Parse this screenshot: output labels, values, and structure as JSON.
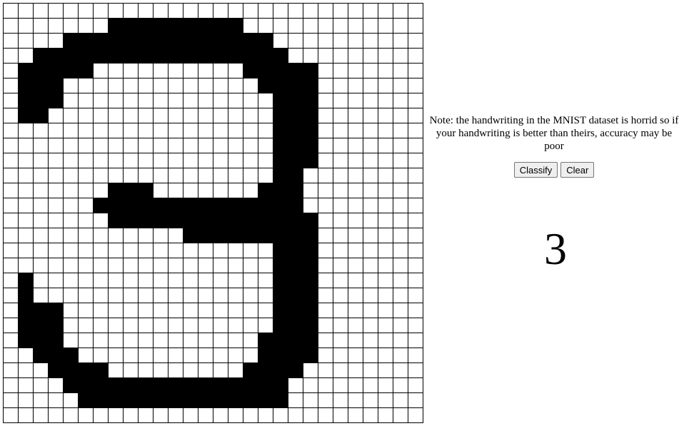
{
  "drawing_grid": {
    "rows": 28,
    "cols": 28,
    "filled": [
      "............................",
      "............................",
      "............................",
      "............................",
      "............................",
      "............................",
      "............................",
      "............................",
      "............................",
      "............................",
      "............................",
      "............................",
      "............................",
      "............................",
      "............................",
      "............................",
      "............................",
      "............................",
      "............................",
      "............................",
      "............................",
      "............................",
      "............................",
      "............................",
      "............................",
      "............................",
      "............................",
      "............................"
    ],
    "filled_cells": [
      [
        1,
        7
      ],
      [
        1,
        8
      ],
      [
        1,
        9
      ],
      [
        1,
        10
      ],
      [
        1,
        11
      ],
      [
        1,
        12
      ],
      [
        1,
        13
      ],
      [
        1,
        14
      ],
      [
        1,
        15
      ],
      [
        2,
        4
      ],
      [
        2,
        5
      ],
      [
        2,
        6
      ],
      [
        2,
        7
      ],
      [
        2,
        8
      ],
      [
        2,
        9
      ],
      [
        2,
        10
      ],
      [
        2,
        11
      ],
      [
        2,
        12
      ],
      [
        2,
        13
      ],
      [
        2,
        14
      ],
      [
        2,
        15
      ],
      [
        2,
        16
      ],
      [
        2,
        17
      ],
      [
        3,
        2
      ],
      [
        3,
        3
      ],
      [
        3,
        4
      ],
      [
        3,
        5
      ],
      [
        3,
        6
      ],
      [
        3,
        7
      ],
      [
        3,
        8
      ],
      [
        3,
        9
      ],
      [
        3,
        10
      ],
      [
        3,
        11
      ],
      [
        3,
        12
      ],
      [
        3,
        13
      ],
      [
        3,
        14
      ],
      [
        3,
        15
      ],
      [
        3,
        16
      ],
      [
        3,
        17
      ],
      [
        3,
        18
      ],
      [
        4,
        1
      ],
      [
        4,
        2
      ],
      [
        4,
        3
      ],
      [
        4,
        4
      ],
      [
        4,
        5
      ],
      [
        4,
        16
      ],
      [
        4,
        17
      ],
      [
        4,
        18
      ],
      [
        4,
        19
      ],
      [
        4,
        20
      ],
      [
        5,
        1
      ],
      [
        5,
        2
      ],
      [
        5,
        3
      ],
      [
        5,
        17
      ],
      [
        5,
        18
      ],
      [
        5,
        19
      ],
      [
        5,
        20
      ],
      [
        6,
        1
      ],
      [
        6,
        2
      ],
      [
        6,
        3
      ],
      [
        6,
        18
      ],
      [
        6,
        19
      ],
      [
        6,
        20
      ],
      [
        7,
        1
      ],
      [
        7,
        2
      ],
      [
        7,
        18
      ],
      [
        7,
        19
      ],
      [
        7,
        20
      ],
      [
        8,
        18
      ],
      [
        8,
        19
      ],
      [
        8,
        20
      ],
      [
        9,
        18
      ],
      [
        9,
        19
      ],
      [
        9,
        20
      ],
      [
        10,
        18
      ],
      [
        10,
        19
      ],
      [
        10,
        20
      ],
      [
        11,
        18
      ],
      [
        11,
        19
      ],
      [
        12,
        7
      ],
      [
        12,
        8
      ],
      [
        12,
        9
      ],
      [
        12,
        17
      ],
      [
        12,
        18
      ],
      [
        12,
        19
      ],
      [
        13,
        6
      ],
      [
        13,
        7
      ],
      [
        13,
        8
      ],
      [
        13,
        9
      ],
      [
        13,
        10
      ],
      [
        13,
        11
      ],
      [
        13,
        12
      ],
      [
        13,
        13
      ],
      [
        13,
        14
      ],
      [
        13,
        15
      ],
      [
        13,
        16
      ],
      [
        13,
        17
      ],
      [
        13,
        18
      ],
      [
        13,
        19
      ],
      [
        14,
        7
      ],
      [
        14,
        8
      ],
      [
        14,
        9
      ],
      [
        14,
        10
      ],
      [
        14,
        11
      ],
      [
        14,
        12
      ],
      [
        14,
        13
      ],
      [
        14,
        14
      ],
      [
        14,
        15
      ],
      [
        14,
        16
      ],
      [
        14,
        17
      ],
      [
        14,
        18
      ],
      [
        14,
        19
      ],
      [
        14,
        20
      ],
      [
        15,
        12
      ],
      [
        15,
        13
      ],
      [
        15,
        14
      ],
      [
        15,
        15
      ],
      [
        15,
        16
      ],
      [
        15,
        17
      ],
      [
        15,
        18
      ],
      [
        15,
        19
      ],
      [
        15,
        20
      ],
      [
        16,
        18
      ],
      [
        16,
        19
      ],
      [
        16,
        20
      ],
      [
        17,
        18
      ],
      [
        17,
        19
      ],
      [
        17,
        20
      ],
      [
        18,
        1
      ],
      [
        18,
        18
      ],
      [
        18,
        19
      ],
      [
        18,
        20
      ],
      [
        19,
        1
      ],
      [
        19,
        18
      ],
      [
        19,
        19
      ],
      [
        19,
        20
      ],
      [
        20,
        1
      ],
      [
        20,
        2
      ],
      [
        20,
        3
      ],
      [
        20,
        18
      ],
      [
        20,
        19
      ],
      [
        20,
        20
      ],
      [
        21,
        1
      ],
      [
        21,
        2
      ],
      [
        21,
        3
      ],
      [
        21,
        18
      ],
      [
        21,
        19
      ],
      [
        21,
        20
      ],
      [
        22,
        1
      ],
      [
        22,
        2
      ],
      [
        22,
        3
      ],
      [
        22,
        17
      ],
      [
        22,
        18
      ],
      [
        22,
        19
      ],
      [
        22,
        20
      ],
      [
        23,
        2
      ],
      [
        23,
        3
      ],
      [
        23,
        4
      ],
      [
        23,
        17
      ],
      [
        23,
        18
      ],
      [
        23,
        19
      ],
      [
        23,
        20
      ],
      [
        24,
        3
      ],
      [
        24,
        4
      ],
      [
        24,
        5
      ],
      [
        24,
        6
      ],
      [
        24,
        16
      ],
      [
        24,
        17
      ],
      [
        24,
        18
      ],
      [
        24,
        19
      ],
      [
        25,
        4
      ],
      [
        25,
        5
      ],
      [
        25,
        6
      ],
      [
        25,
        7
      ],
      [
        25,
        8
      ],
      [
        25,
        9
      ],
      [
        25,
        10
      ],
      [
        25,
        11
      ],
      [
        25,
        12
      ],
      [
        25,
        13
      ],
      [
        25,
        14
      ],
      [
        25,
        15
      ],
      [
        25,
        16
      ],
      [
        25,
        17
      ],
      [
        25,
        18
      ],
      [
        26,
        5
      ],
      [
        26,
        6
      ],
      [
        26,
        7
      ],
      [
        26,
        8
      ],
      [
        26,
        9
      ],
      [
        26,
        10
      ],
      [
        26,
        11
      ],
      [
        26,
        12
      ],
      [
        26,
        13
      ],
      [
        26,
        14
      ],
      [
        26,
        15
      ],
      [
        26,
        16
      ],
      [
        26,
        17
      ],
      [
        26,
        18
      ]
    ]
  },
  "note": "Note: the handwriting in the MNIST dataset is horrid so if your handwriting is better than theirs, accuracy may be poor",
  "buttons": {
    "classify_label": "Classify",
    "clear_label": "Clear"
  },
  "prediction": "3",
  "colors": {
    "filled_cell": "#000000",
    "empty_cell": "#ffffff",
    "grid_line": "#000000"
  }
}
